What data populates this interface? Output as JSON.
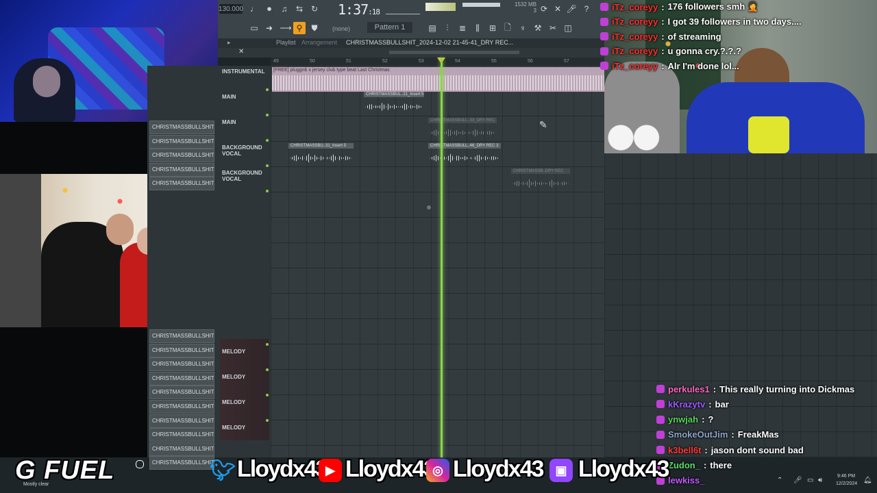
{
  "fl_studio": {
    "tempo": "130.000",
    "song_time": "1:37",
    "song_time_sub": ":18",
    "memory": "1532 MB",
    "memory_sub": "3",
    "pattern": "Pattern 1",
    "none_label": "(none)",
    "playlist_label": "Playlist",
    "arrangement_label": "Arrangement",
    "project_title": "CHRISTMASSBULLSHIT_2024-12-02 21-45-41_DRY REC...",
    "ruler_ticks": [
      "49",
      "50",
      "51",
      "52",
      "53",
      "54",
      "55",
      "56",
      "57"
    ],
    "tracks": [
      {
        "label": "INSTRUMENTAL"
      },
      {
        "label": "MAIN"
      },
      {
        "label": "MAIN"
      },
      {
        "label": "BACKGROUND VOCAL"
      },
      {
        "label": "BACKGROUND VOCAL"
      }
    ],
    "melody_tracks": [
      "MELODY",
      "MELODY",
      "MELODY",
      "MELODY"
    ],
    "clip_list_top": [
      "CHRISTMASSBULLSHIT_20...",
      "CHRISTMASSBULLSHIT_20...",
      "CHRISTMASSBULLSHIT_20...",
      "CHRISTMASSBULLSHIT_20...",
      "CHRISTMASSBULLSHIT_20..."
    ],
    "clip_list_bottom": [
      "CHRISTMASSBULLSHIT_20...",
      "CHRISTMASSBULLSHIT_20...",
      "CHRISTMASSBULLSHIT_20...",
      "CHRISTMASSBULLSHIT_20...",
      "CHRISTMASSBULLSHIT_20...",
      "CHRISTMASSBULLSHIT_20...",
      "CHRISTMASSBULLSHIT_20...",
      "CHRISTMASSBULLSHIT_20...",
      "CHRISTMASSBULLSHIT_20...",
      "CHRISTMASSBULLSHIT_20..."
    ],
    "instrumental_clip": "[FREE] pluggnb x jersey club type beat Last Christmas",
    "audio_clips": [
      {
        "title": "CHRISTMASSBUL..21_Insert 5"
      },
      {
        "title": "CHRISTMASSBULL..33_DRY REC"
      },
      {
        "title": "CHRISTMASSBU..31_Insert 5"
      },
      {
        "title": "CHRISTMASSBULL..46_DRY REC 3"
      },
      {
        "title": "CHRISTMASSB..DRY REC"
      }
    ]
  },
  "chat_top": [
    {
      "user": "iTz_coreyy",
      "message": "176 followers smh 🤦",
      "user_color": "#ff2d2d"
    },
    {
      "user": "iTz_coreyy",
      "message": "I got 39 followers in two days....",
      "user_color": "#ff2d2d"
    },
    {
      "user": "iTz_coreyy",
      "message": "of streaming",
      "user_color": "#ff2d2d"
    },
    {
      "user": "iTz_coreyy",
      "message": "u gonna cry.?.?.?",
      "user_color": "#ff2d2d"
    },
    {
      "user": "iTz_coreyy",
      "message": "Alr I'm done lol...",
      "user_color": "#ff2d2d"
    }
  ],
  "chat_bottom": [
    {
      "user": "perkules1",
      "message": "This really turning into Dickmas",
      "user_color": "#ff66c4"
    },
    {
      "user": "kKrazytv",
      "message": "bar",
      "user_color": "#9b59ff"
    },
    {
      "user": "ynwjah",
      "message": "?",
      "user_color": "#5bd45b"
    },
    {
      "user": "SmokeOutJim",
      "message": "FreakMas",
      "user_color": "#8fa5c9"
    },
    {
      "user": "k3bell6t",
      "message": "jason dont sound bad",
      "user_color": "#ff3b3b"
    },
    {
      "user": "Zudon_",
      "message": "there",
      "user_color": "#58e06a"
    },
    {
      "user": "lewkiss_",
      "message": "",
      "user_color": "#c25bff"
    }
  ],
  "branding": {
    "gfuel": "G FUEL",
    "twitter_handle": "Lloydx43",
    "youtube_handle": "Lloydx43",
    "instagram_handle": "Lloydx43",
    "twitch_handle": "Lloydx43"
  },
  "taskbar": {
    "weather": "Mostly clear",
    "time": "9:46 PM",
    "date": "12/2/2024"
  },
  "colors": {
    "playhead": "#8bd44a",
    "instrumental_clip": "#b8a4b4",
    "twitter": "#1da1f2",
    "youtube": "#ff0000",
    "instagram": "#d6249f",
    "twitch": "#9146ff"
  }
}
